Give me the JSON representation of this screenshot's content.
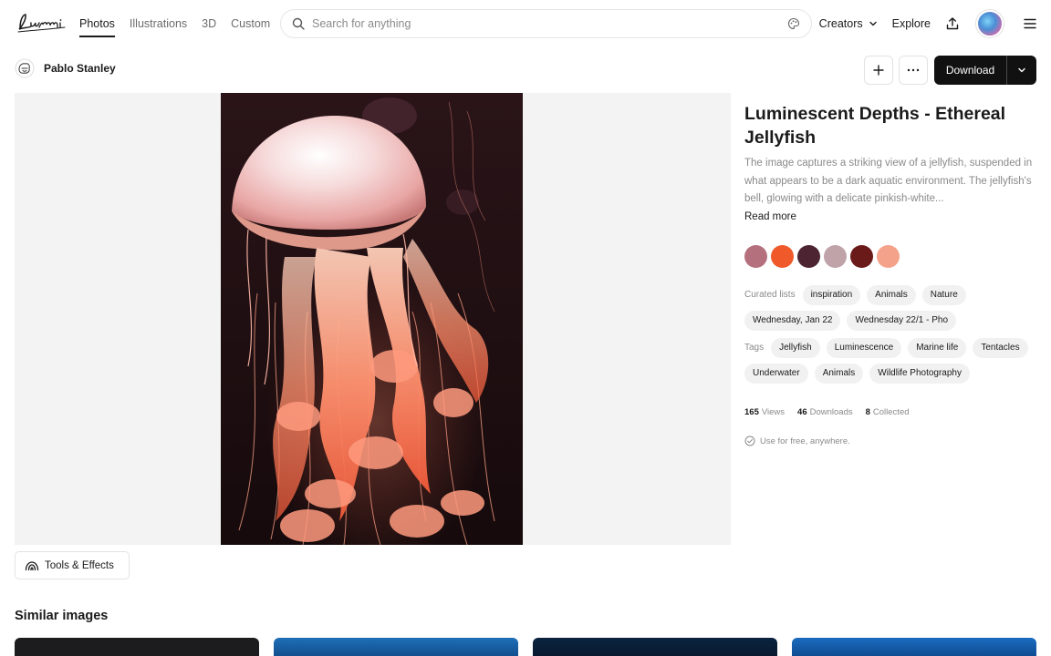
{
  "nav": {
    "tabs": [
      {
        "label": "Photos",
        "active": true
      },
      {
        "label": "Illustrations",
        "active": false
      },
      {
        "label": "3D",
        "active": false
      },
      {
        "label": "Custom",
        "active": false
      }
    ],
    "search_placeholder": "Search for anything",
    "creators_label": "Creators",
    "explore_label": "Explore",
    "icons": [
      "search-icon",
      "palette-icon",
      "chevron-down-icon",
      "upload-icon",
      "menu-icon"
    ]
  },
  "author": {
    "name": "Pablo Stanley"
  },
  "actions": {
    "download_label": "Download"
  },
  "details": {
    "title": "Luminescent Depths - Ethereal Jellyfish",
    "description": "The image captures a striking view of a jellyfish, suspended in what appears to be a dark aquatic environment. The jellyfish's bell, glowing with a delicate pinkish-white...",
    "read_more": "Read more",
    "palette": [
      "#b5707e",
      "#f05a2a",
      "#4c2432",
      "#bfa3a9",
      "#6b1a1a",
      "#f4a28a"
    ],
    "curated_label": "Curated lists",
    "curated": [
      "inspiration",
      "Animals",
      "Nature",
      "Wednesday, Jan 22",
      "Wednesday 22/1 - Pho"
    ],
    "tags_label": "Tags",
    "tags": [
      "Jellyfish",
      "Luminescence",
      "Marine life",
      "Tentacles",
      "Underwater",
      "Animals",
      "Wildlife Photography"
    ],
    "stats": {
      "views": "165",
      "views_label": "Views",
      "downloads": "46",
      "downloads_label": "Downloads",
      "collected": "8",
      "collected_label": "Collected"
    },
    "license": "Use for free, anywhere."
  },
  "tools": {
    "label": "Tools & Effects"
  },
  "similar": {
    "title": "Similar images"
  }
}
